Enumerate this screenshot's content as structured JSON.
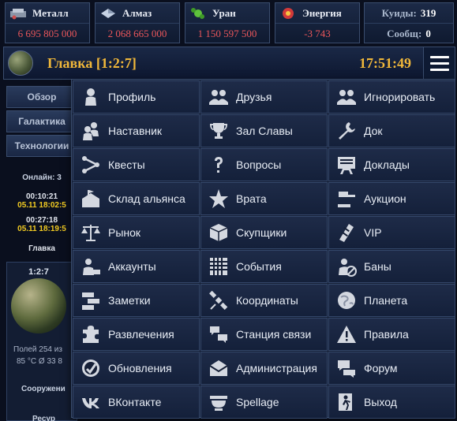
{
  "resources": [
    {
      "name": "Металл",
      "value": "6 695 805 000",
      "icon": "metal-icon"
    },
    {
      "name": "Алмаз",
      "value": "2 068 665 000",
      "icon": "crystal-icon"
    },
    {
      "name": "Уран",
      "value": "1 150 597 500",
      "icon": "uranium-icon"
    },
    {
      "name": "Энергия",
      "value": "-3 743",
      "icon": "energy-icon"
    }
  ],
  "stats": {
    "credits_label": "Куиды:",
    "credits_value": "319",
    "messages_label": "Сообщ:",
    "messages_value": "0"
  },
  "header": {
    "title": "Главка [1:2:7]",
    "clock": "17:51:49",
    "menu_icon": "hamburger-icon"
  },
  "background": {
    "tabs": [
      "Обзор",
      "Галактика",
      "Технологии"
    ],
    "online_label": "Онлайн:  3",
    "events": [
      {
        "time": "00:10:21",
        "date": "05.11 18:02:5"
      },
      {
        "time": "00:27:18",
        "date": "05.11 18:19:5"
      }
    ],
    "planet_name": "Главка",
    "planet_coords": "1:2:7",
    "fields_line": "Полей 254 из",
    "temp_line": "85 °C   Ø 33 8",
    "build_label": "Сооружени",
    "res_label": "Ресур"
  },
  "menu": [
    {
      "label": "Профиль",
      "icon": "profile-icon"
    },
    {
      "label": "Друзья",
      "icon": "friends-icon"
    },
    {
      "label": "Игнорировать",
      "icon": "ignore-icon"
    },
    {
      "label": "Наставник",
      "icon": "mentor-icon"
    },
    {
      "label": "Зал Славы",
      "icon": "trophy-icon"
    },
    {
      "label": "Док",
      "icon": "wrench-icon"
    },
    {
      "label": "Квесты",
      "icon": "quests-icon"
    },
    {
      "label": "Вопросы",
      "icon": "question-icon"
    },
    {
      "label": "Доклады",
      "icon": "reports-icon"
    },
    {
      "label": "Склад альянса",
      "icon": "alliance-warehouse-icon"
    },
    {
      "label": "Врата",
      "icon": "gate-icon"
    },
    {
      "label": "Аукцион",
      "icon": "auction-gavel-icon"
    },
    {
      "label": "Рынок",
      "icon": "scales-icon"
    },
    {
      "label": "Скупщики",
      "icon": "box-icon"
    },
    {
      "label": "VIP",
      "icon": "vip-icon"
    },
    {
      "label": "Аккаунты",
      "icon": "accounts-icon"
    },
    {
      "label": "События",
      "icon": "calendar-icon"
    },
    {
      "label": "Баны",
      "icon": "ban-icon"
    },
    {
      "label": "Заметки",
      "icon": "notes-icon"
    },
    {
      "label": "Координаты",
      "icon": "satellite-icon"
    },
    {
      "label": "Планета",
      "icon": "planet-icon"
    },
    {
      "label": "Развлечения",
      "icon": "puzzle-icon"
    },
    {
      "label": "Станция связи",
      "icon": "chat-station-icon"
    },
    {
      "label": "Правила",
      "icon": "warning-icon"
    },
    {
      "label": "Обновления",
      "icon": "update-icon"
    },
    {
      "label": "Администрация",
      "icon": "mail-icon"
    },
    {
      "label": "Форум",
      "icon": "forum-icon"
    },
    {
      "label": "ВКонтакте",
      "icon": "vk-icon"
    },
    {
      "label": "Spellage",
      "icon": "cauldron-icon"
    },
    {
      "label": "Выход",
      "icon": "exit-icon"
    }
  ]
}
